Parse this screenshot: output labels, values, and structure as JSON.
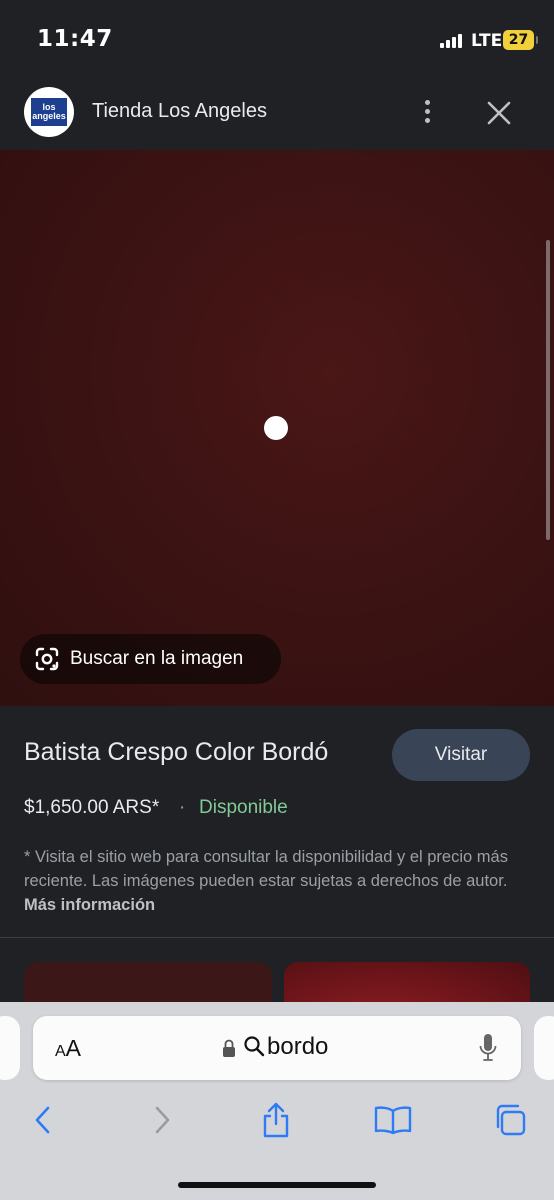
{
  "status_bar": {
    "time": "11:47",
    "network": "LTE",
    "battery": "27"
  },
  "header": {
    "logo_text_line1": "los",
    "logo_text_line2": "angeles",
    "site_name": "Tienda Los Angeles"
  },
  "image_viewer": {
    "lens_label": "Buscar en la imagen"
  },
  "product": {
    "title": "Batista Crespo Color Bordó",
    "visit_label": "Visitar",
    "price": "$1,650.00 ARS*",
    "separator": "·",
    "availability": "Disponible",
    "disclaimer": "* Visita el sitio web para consultar la disponibilidad y el precio más reciente. Las imágenes pueden estar sujetas a derechos de autor.",
    "more_info_label": "Más información"
  },
  "browser": {
    "text_size_small": "A",
    "text_size_large": "A",
    "address": "bordo"
  },
  "colors": {
    "background": "#202124",
    "image_tint": "#3d1313",
    "availability": "#81c995",
    "visit_button": "#394457",
    "battery": "#f2d03b",
    "safari_accent": "#2f7bf5"
  },
  "icons": [
    "more-vert-icon",
    "close-icon",
    "google-lens-icon",
    "lock-icon",
    "search-icon",
    "mic-icon",
    "back-icon",
    "forward-icon",
    "share-icon",
    "bookmarks-icon",
    "tabs-icon"
  ]
}
